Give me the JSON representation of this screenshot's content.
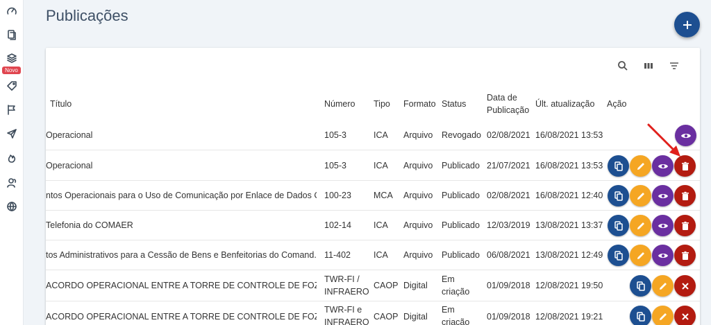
{
  "sidebar": {
    "items": [
      {
        "icon": "speedometer-icon"
      },
      {
        "icon": "document-copy-icon"
      },
      {
        "icon": "layers-icon",
        "badge": "Novo"
      },
      {
        "icon": "tag-icon"
      },
      {
        "icon": "flag-icon"
      },
      {
        "icon": "send-icon"
      },
      {
        "icon": "fire-icon"
      },
      {
        "icon": "users-icon"
      },
      {
        "icon": "globe-icon"
      }
    ]
  },
  "page": {
    "title": "Publicações"
  },
  "fab": {
    "label": "+"
  },
  "table": {
    "columns": {
      "titulo": "Título",
      "numero": "Número",
      "tipo": "Tipo",
      "formato": "Formato",
      "status": "Status",
      "data_pub_1": "Data de",
      "data_pub_2": "Publicação",
      "atualizacao": "Últ. atualização",
      "acao": "Ação"
    },
    "rows": [
      {
        "titulo": "Operacional",
        "numero": "105-3",
        "tipo": "ICA",
        "formato": "Arquivo",
        "status": "Revogado",
        "data": "02/08/2021",
        "atualizacao": "16/08/2021 13:53"
      },
      {
        "titulo": "Operacional",
        "numero": "105-3",
        "tipo": "ICA",
        "formato": "Arquivo",
        "status": "Publicado",
        "data": "21/07/2021",
        "atualizacao": "16/08/2021 13:53"
      },
      {
        "titulo": "ntos Operacionais para o Uso de Comunicação por Enlace de Dados C...",
        "numero": "100-23",
        "tipo": "MCA",
        "formato": "Arquivo",
        "status": "Publicado",
        "data": "02/08/2021",
        "atualizacao": "16/08/2021 12:40"
      },
      {
        "titulo": "Telefonia do COMAER",
        "numero": "102-14",
        "tipo": "ICA",
        "formato": "Arquivo",
        "status": "Publicado",
        "data": "12/03/2019",
        "atualizacao": "13/08/2021 13:37"
      },
      {
        "titulo": "tos Administrativos para a Cessão de Bens e Benfeitorias do Comand...",
        "numero": "11-402",
        "tipo": "ICA",
        "formato": "Arquivo",
        "status": "Publicado",
        "data": "06/08/2021",
        "atualizacao": "13/08/2021 12:49"
      },
      {
        "titulo": "ACORDO OPERACIONAL ENTRE A TORRE DE CONTROLE DE FOZ...",
        "numero_1": "TWR-FI /",
        "numero_2": "INFRAERO",
        "tipo": "CAOP",
        "formato": "Digital",
        "status_1": "Em",
        "status_2": "criação",
        "data": "01/09/2018",
        "atualizacao": "12/08/2021 19:50"
      },
      {
        "titulo": "ACORDO OPERACIONAL ENTRE A TORRE DE CONTROLE DE FOZ...",
        "numero_1": "TWR-FI e",
        "numero_2": "INFRAERO",
        "tipo": "CAOP",
        "formato": "Digital",
        "status_1": "Em",
        "status_2": "criação",
        "data": "01/09/2018",
        "atualizacao": "12/08/2021 19:21"
      }
    ]
  },
  "colors": {
    "primary": "#1d4f91",
    "edit": "#f5a623",
    "view": "#6a2fa0",
    "delete": "#b31b10",
    "badge": "#e0454f"
  }
}
